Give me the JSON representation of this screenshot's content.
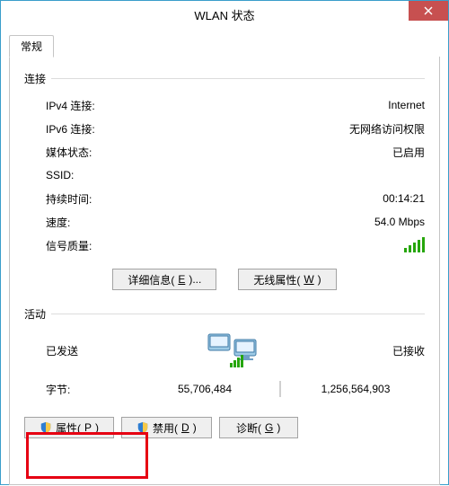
{
  "window": {
    "title": "WLAN 状态"
  },
  "tabs": {
    "general": "常规"
  },
  "groups": {
    "connection": "连接",
    "activity": "活动"
  },
  "conn": {
    "ipv4_label": "IPv4 连接:",
    "ipv4_value": "Internet",
    "ipv6_label": "IPv6 连接:",
    "ipv6_value": "无网络访问权限",
    "media_label": "媒体状态:",
    "media_value": "已启用",
    "ssid_label": "SSID:",
    "ssid_value": "",
    "duration_label": "持续时间:",
    "duration_value": "00:14:21",
    "speed_label": "速度:",
    "speed_value": "54.0 Mbps",
    "signal_label": "信号质量:"
  },
  "buttons": {
    "details_pre": "详细信息(",
    "details_key": "E",
    "details_post": ")...",
    "wireless_pre": "无线属性(",
    "wireless_key": "W",
    "wireless_post": ")",
    "properties_pre": "属性(",
    "properties_key": "P",
    "properties_post": ")",
    "disable_pre": "禁用(",
    "disable_key": "D",
    "disable_post": ")",
    "diagnose_pre": "诊断(",
    "diagnose_key": "G",
    "diagnose_post": ")"
  },
  "activity": {
    "sent_label": "已发送",
    "recv_label": "已接收",
    "bytes_label": "字节:",
    "sent_bytes": "55,706,484",
    "recv_bytes": "1,256,564,903"
  }
}
